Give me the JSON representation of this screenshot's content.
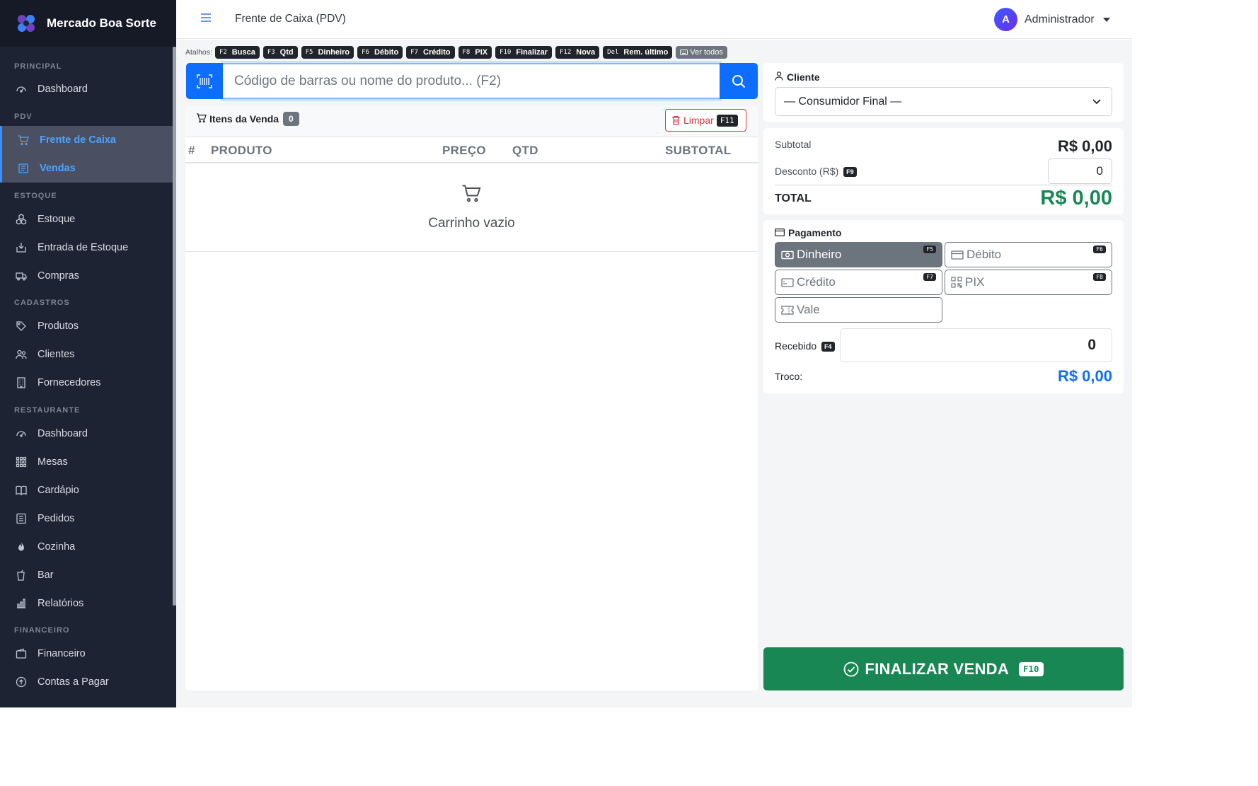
{
  "brand": {
    "name": "Mercado Boa Sorte"
  },
  "sidebar": {
    "sections": [
      "PRINCIPAL",
      "PDV",
      "ESTOQUE",
      "CADASTROS",
      "RESTAURANTE",
      "FINANCEIRO"
    ],
    "items": [
      {
        "label": "Dashboard",
        "icon": "gauge-icon"
      },
      {
        "label": "Frente de Caixa",
        "icon": "cart-icon",
        "active": true
      },
      {
        "label": "Vendas",
        "icon": "receipt-icon",
        "active": true
      },
      {
        "label": "Estoque",
        "icon": "boxes-icon"
      },
      {
        "label": "Entrada de Estoque",
        "icon": "box-arrow-in-icon"
      },
      {
        "label": "Compras",
        "icon": "truck-icon"
      },
      {
        "label": "Produtos",
        "icon": "tag-icon"
      },
      {
        "label": "Clientes",
        "icon": "people-icon"
      },
      {
        "label": "Fornecedores",
        "icon": "building-icon"
      },
      {
        "label": "Dashboard",
        "icon": "gauge-icon"
      },
      {
        "label": "Mesas",
        "icon": "grid-icon"
      },
      {
        "label": "Cardápio",
        "icon": "book-icon"
      },
      {
        "label": "Pedidos",
        "icon": "list-icon"
      },
      {
        "label": "Cozinha",
        "icon": "fire-icon"
      },
      {
        "label": "Bar",
        "icon": "cup-icon"
      },
      {
        "label": "Relatórios",
        "icon": "bar-chart-icon"
      },
      {
        "label": "Financeiro",
        "icon": "wallet-icon"
      },
      {
        "label": "Contas a Pagar",
        "icon": "arrow-up-circle-icon"
      }
    ]
  },
  "header": {
    "title": "Frente de Caixa (PDV)",
    "user_initial": "A",
    "user_name": "Administrador"
  },
  "shortcuts": {
    "label": "Atalhos:",
    "items": [
      {
        "key": "F2",
        "label": "Busca"
      },
      {
        "key": "F3",
        "label": "Qtd"
      },
      {
        "key": "F5",
        "label": "Dinheiro"
      },
      {
        "key": "F6",
        "label": "Débito"
      },
      {
        "key": "F7",
        "label": "Crédito"
      },
      {
        "key": "F8",
        "label": "PIX"
      },
      {
        "key": "F10",
        "label": "Finalizar"
      },
      {
        "key": "F12",
        "label": "Nova"
      },
      {
        "key": "Del",
        "label": "Rem. último"
      }
    ],
    "all_label": "Ver todos"
  },
  "search": {
    "placeholder": "Código de barras ou nome do produto... (F2)"
  },
  "items": {
    "title": "Itens da Venda",
    "count": "0",
    "clear_label": "Limpar",
    "clear_key": "F11",
    "columns": [
      "#",
      "PRODUTO",
      "PREÇO",
      "QTD",
      "SUBTOTAL"
    ],
    "empty_text": "Carrinho vazio"
  },
  "client": {
    "title": "Cliente",
    "selected": "— Consumidor Final —"
  },
  "totals": {
    "subtotal_label": "Subtotal",
    "subtotal_value": "R$ 0,00",
    "discount_label": "Desconto (R$)",
    "discount_key": "F9",
    "discount_value": "0",
    "total_label": "TOTAL",
    "total_value": "R$ 0,00"
  },
  "payment": {
    "title": "Pagamento",
    "methods": [
      {
        "label": "Dinheiro",
        "key": "F5",
        "active": true
      },
      {
        "label": "Débito",
        "key": "F6"
      },
      {
        "label": "Crédito",
        "key": "F7"
      },
      {
        "label": "PIX",
        "key": "F8"
      },
      {
        "label": "Vale",
        "key": ""
      }
    ],
    "received_label": "Recebido",
    "received_key": "F4",
    "received_value": "0",
    "change_label": "Troco:",
    "change_value": "R$ 0,00"
  },
  "finalize": {
    "label": "FINALIZAR VENDA",
    "key": "F10"
  },
  "colors": {
    "primary": "#0d6efd",
    "success": "#198754",
    "sidebar": "#1e2333",
    "danger": "#dc3545"
  }
}
